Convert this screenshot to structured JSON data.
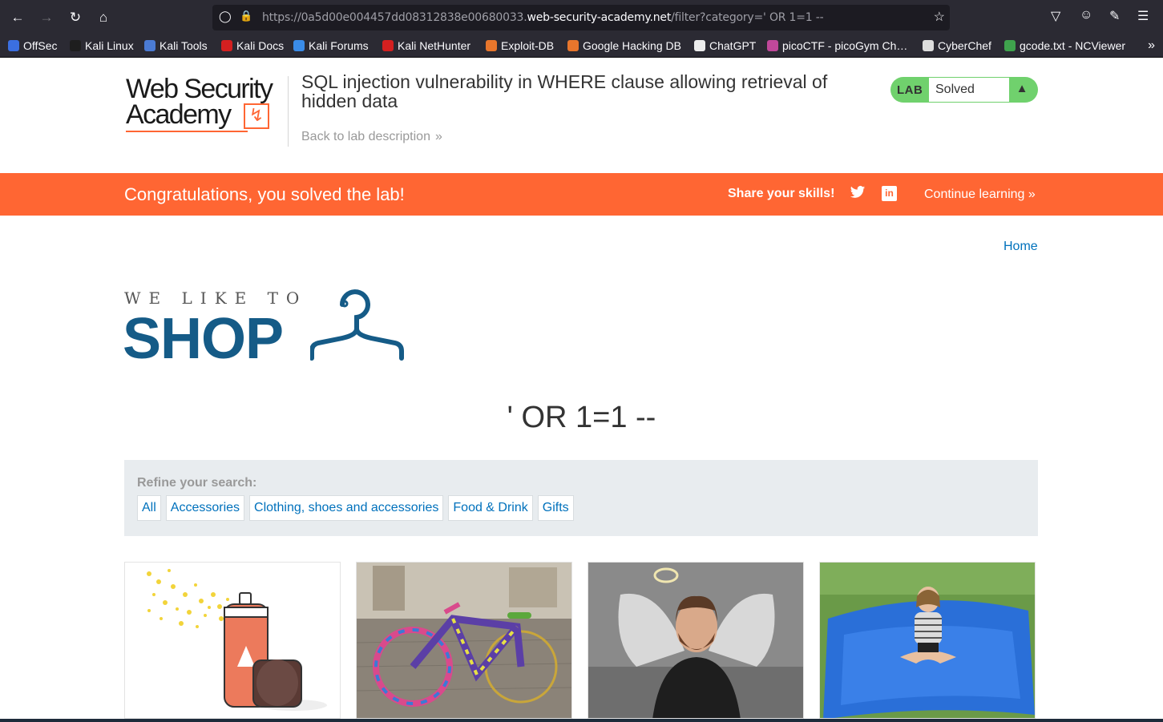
{
  "browser": {
    "url_prefix": "https://0a5d00e004457dd08312838e00680033.",
    "url_domain": "web-security-academy.net",
    "url_path": "/filter?category=' OR 1=1 --",
    "bookmarks": [
      {
        "label": "OffSec",
        "color": "#3b6fe0"
      },
      {
        "label": "Kali Linux",
        "color": "#1e1e1e"
      },
      {
        "label": "Kali Tools",
        "color": "#4b7bd4"
      },
      {
        "label": "Kali Docs",
        "color": "#d42020"
      },
      {
        "label": "Kali Forums",
        "color": "#3a8ce8"
      },
      {
        "label": "Kali NetHunter",
        "color": "#d42020"
      },
      {
        "label": "Exploit-DB",
        "color": "#e8762c"
      },
      {
        "label": "Google Hacking DB",
        "color": "#e8762c"
      },
      {
        "label": "ChatGPT",
        "color": "#ececec"
      },
      {
        "label": "picoCTF - picoGym Ch…",
        "color": "#c0489a"
      },
      {
        "label": "CyberChef",
        "color": "#dddddd"
      },
      {
        "label": "gcode.txt - NCViewer",
        "color": "#3fa34d"
      }
    ]
  },
  "academy": {
    "logo_line1": "Web Security",
    "logo_line2": "Academy",
    "lab_title": "SQL injection vulnerability in WHERE clause allowing retrieval of hidden data",
    "back_link": "Back to lab description",
    "lab_badge": "LAB",
    "lab_status": "Solved",
    "accent": "#ff6633",
    "solved_color": "#70d16d"
  },
  "banner": {
    "congrats": "Congratulations, you solved the lab!",
    "share": "Share your skills!",
    "continue": "Continue learning"
  },
  "shop": {
    "home": "Home",
    "tagline": "WE LIKE TO",
    "name": "SHOP",
    "brand_color": "#155b87",
    "heading": "' OR 1=1 --",
    "refine": "Refine your search:",
    "categories": [
      "All",
      "Accessories",
      "Clothing, shoes and accessories",
      "Food & Drink",
      "Gifts"
    ],
    "link_color": "#0071bc"
  }
}
